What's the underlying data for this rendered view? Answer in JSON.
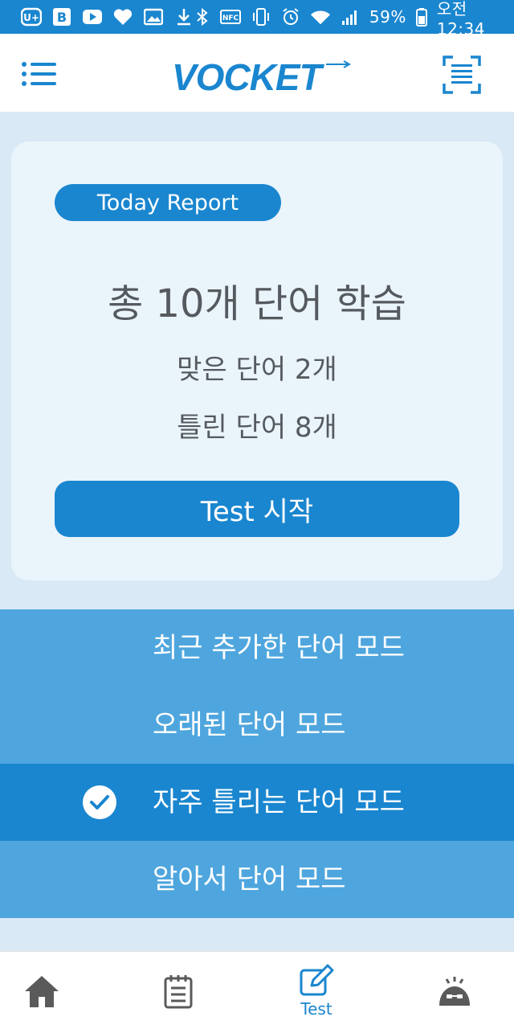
{
  "status_bar": {
    "battery_percent": "59%",
    "time": "오전 12:34",
    "nfc_label": "NFC",
    "left_icons": [
      "u-plus-icon",
      "b-icon",
      "youtube-icon",
      "heart-icon",
      "image-icon",
      "download-icon"
    ],
    "right_icons": [
      "bluetooth-icon",
      "nfc-icon",
      "vibrate-icon",
      "alarm-icon",
      "wifi-icon",
      "signal-icon",
      "battery-icon"
    ]
  },
  "header": {
    "logo_text": "VOCKET",
    "menu_icon": "menu-list-icon",
    "scan_icon": "scan-icon"
  },
  "report": {
    "badge": "Today Report",
    "total": "총 10개 단어 학습",
    "correct": "맞은 단어 2개",
    "wrong": "틀린 단어 8개",
    "start_button": "Test 시작"
  },
  "modes": [
    {
      "label": "최근 추가한 단어 모드",
      "selected": false
    },
    {
      "label": "오래된 단어 모드",
      "selected": false
    },
    {
      "label": "자주 틀리는 단어 모드",
      "selected": true
    },
    {
      "label": "알아서 단어 모드",
      "selected": false
    }
  ],
  "bottom_nav": {
    "home_icon": "home-icon",
    "notes_icon": "notes-icon",
    "test_label": "Test",
    "test_icon": "edit-icon",
    "profile_icon": "user-icon",
    "active": "test"
  },
  "colors": {
    "primary": "#1a86cf",
    "mode_bg": "#4fa6de",
    "page_bg": "#d9e9f6",
    "card_bg": "#eaf4fb",
    "text_gray": "#555a5f"
  }
}
